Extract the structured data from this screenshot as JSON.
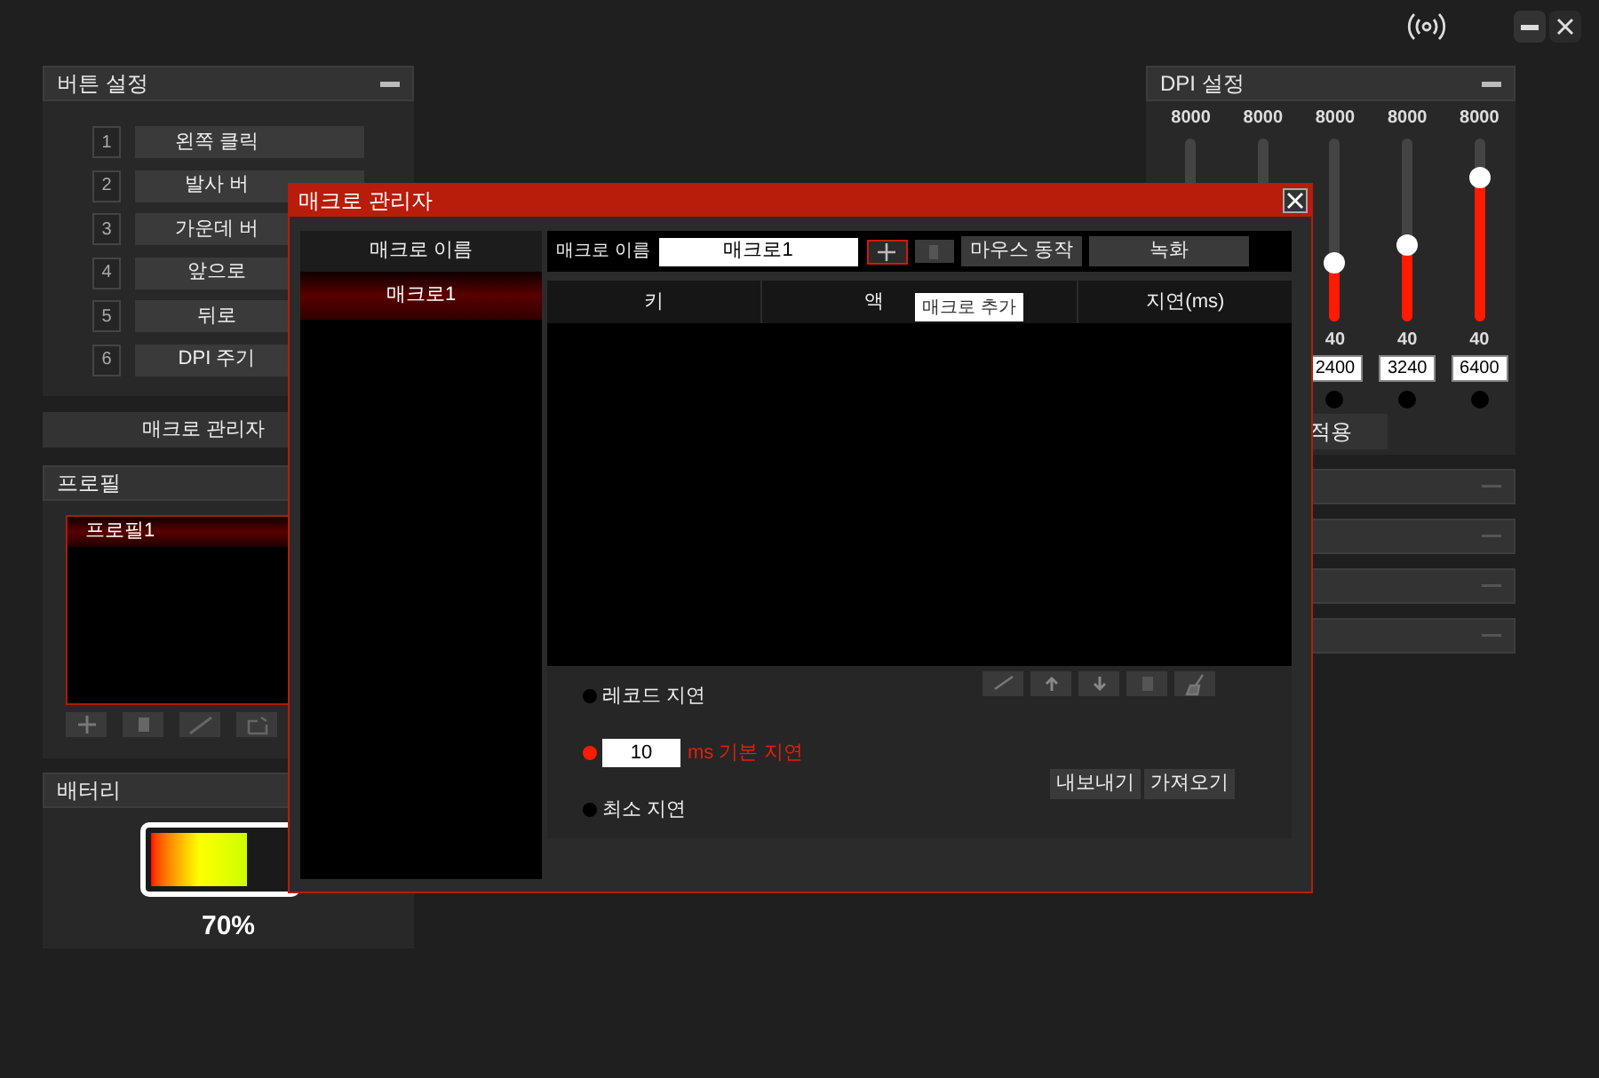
{
  "button_settings": {
    "title": "버튼 설정",
    "rows": [
      {
        "number": "1",
        "label": "왼쪽 클릭"
      },
      {
        "number": "2",
        "label": "발사 버"
      },
      {
        "number": "3",
        "label": "가운데 버"
      },
      {
        "number": "4",
        "label": "앞으로"
      },
      {
        "number": "5",
        "label": "뒤로"
      },
      {
        "number": "6",
        "label": "DPI 주기"
      }
    ]
  },
  "macro_manager_button": "매크로 관리자",
  "profile": {
    "title": "프로필",
    "items": [
      {
        "label": "프로필1",
        "selected": true
      }
    ]
  },
  "battery": {
    "title": "배터리",
    "level": 0.7,
    "reading": "70%"
  },
  "dpi_settings": {
    "title": "DPI 설정",
    "sliders": [
      {
        "kind": "partial",
        "max": "8000"
      },
      {
        "kind": "partial",
        "max": "8000"
      },
      {
        "kind": "full",
        "max": "8000",
        "level": 0.32,
        "min": "40",
        "value": "2400",
        "selected": false
      },
      {
        "kind": "full",
        "max": "8000",
        "level": 0.42,
        "min": "40",
        "value": "3240",
        "selected": false
      },
      {
        "kind": "full",
        "max": "8000",
        "level": 0.79,
        "min": "40",
        "value": "6400",
        "selected": false
      }
    ],
    "apply_button": "적용"
  },
  "collapsed_sections": [
    {
      "collapsed": true
    },
    {
      "collapsed": true
    },
    {
      "collapsed": true
    },
    {
      "collapsed": true
    }
  ],
  "macro_dialog": {
    "title": "매크로 관리자",
    "list_header": "매크로 이름",
    "macros": [
      {
        "label": "매크로1",
        "selected": true
      }
    ],
    "name_label": "매크로 이름",
    "name_value": "매크로1",
    "mouse_action_button": "마우스 동작",
    "record_button": "녹화",
    "tooltip": "매크로 추가",
    "columns": [
      "키",
      "액",
      "지연(ms)"
    ],
    "delay_options": [
      {
        "kind": "label",
        "label": "레코드 지연",
        "selected": false
      },
      {
        "kind": "input",
        "value": "10",
        "label": "ms 기본 지연",
        "selected": true
      },
      {
        "kind": "label",
        "label": "최소 지연",
        "selected": false
      }
    ],
    "export_button": "내보내기",
    "import_button": "가져오기"
  }
}
